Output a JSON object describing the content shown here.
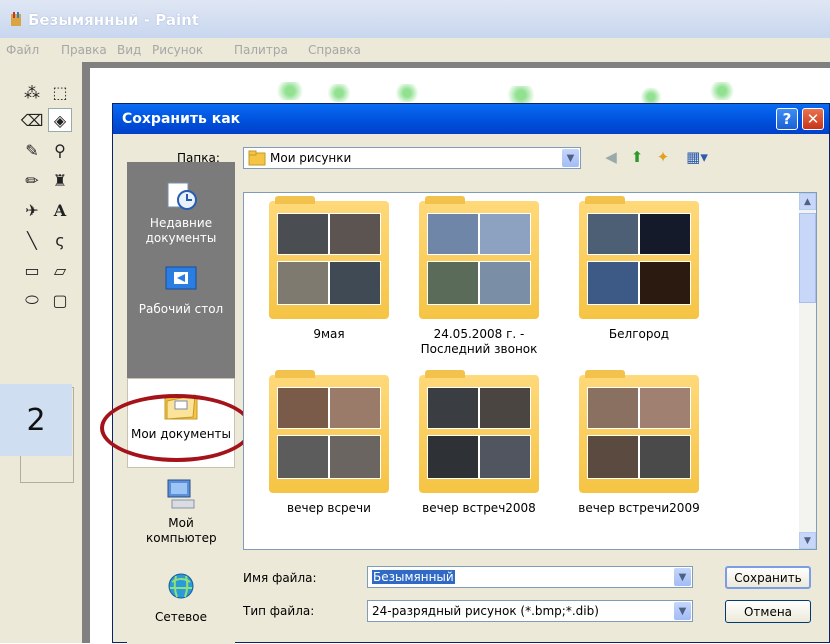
{
  "app": {
    "title": "Безымянный - Paint"
  },
  "menu": [
    "Файл",
    "Правка",
    "Вид",
    "Рисунок",
    "Палитра",
    "Справка"
  ],
  "overlay_number": "2",
  "dialog": {
    "title": "Сохранить как",
    "help_label": "?",
    "close_label": "✕",
    "folder_label": "Папка:",
    "folder_value": "Мои рисунки",
    "places": [
      {
        "label": "Недавние документы",
        "icon": "recent-documents-icon"
      },
      {
        "label": "Рабочий стол",
        "icon": "desktop-icon"
      },
      {
        "label": "Мои документы",
        "icon": "my-documents-icon"
      },
      {
        "label": "Мой компьютер",
        "icon": "my-computer-icon"
      },
      {
        "label": "Сетевое",
        "icon": "network-icon"
      }
    ],
    "folders": [
      {
        "label": "9мая"
      },
      {
        "label": "24.05.2008 г. - Последний звонок"
      },
      {
        "label": "Белгород"
      },
      {
        "label": "вечер всречи"
      },
      {
        "label": "вечер встреч2008"
      },
      {
        "label": "вечер встречи2009"
      }
    ],
    "filename_label": "Имя файла:",
    "filename_value": "Безымянный",
    "filetype_label": "Тип файла:",
    "filetype_value": "24-разрядный рисунок (*.bmp;*.dib)",
    "save_button": "Сохранить",
    "cancel_button": "Отмена"
  },
  "colors": {
    "titlebar": "#0053e0",
    "dialog_bg": "#ece9d8",
    "highlight_circle": "#a31319",
    "folder": "#f5c444"
  }
}
